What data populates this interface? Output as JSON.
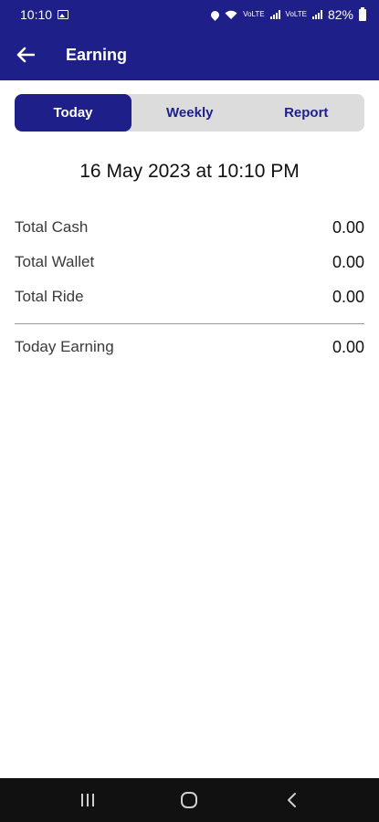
{
  "status_bar": {
    "time": "10:10",
    "battery": "82%",
    "network_label_1": "VoLTE",
    "network_label_2": "VoLTE"
  },
  "app_bar": {
    "title": "Earning",
    "back_icon": "arrow-left-icon"
  },
  "tabs": [
    {
      "label": "Today",
      "active": true
    },
    {
      "label": "Weekly",
      "active": false
    },
    {
      "label": "Report",
      "active": false
    }
  ],
  "date_text": "16 May 2023 at 10:10 PM",
  "summary": {
    "rows": [
      {
        "label": "Total Cash",
        "value": "0.00"
      },
      {
        "label": "Total Wallet",
        "value": "0.00"
      },
      {
        "label": "Total Ride",
        "value": "0.00"
      }
    ],
    "total": {
      "label": "Today Earning",
      "value": "0.00"
    }
  },
  "nav_bar": {
    "recents_icon": "recents-icon",
    "home_icon": "home-icon",
    "back_icon": "back-chevron-icon"
  },
  "colors": {
    "primary": "#1f1f8a",
    "tab_background": "#dcdcdc",
    "nav_bar": "#111111"
  }
}
